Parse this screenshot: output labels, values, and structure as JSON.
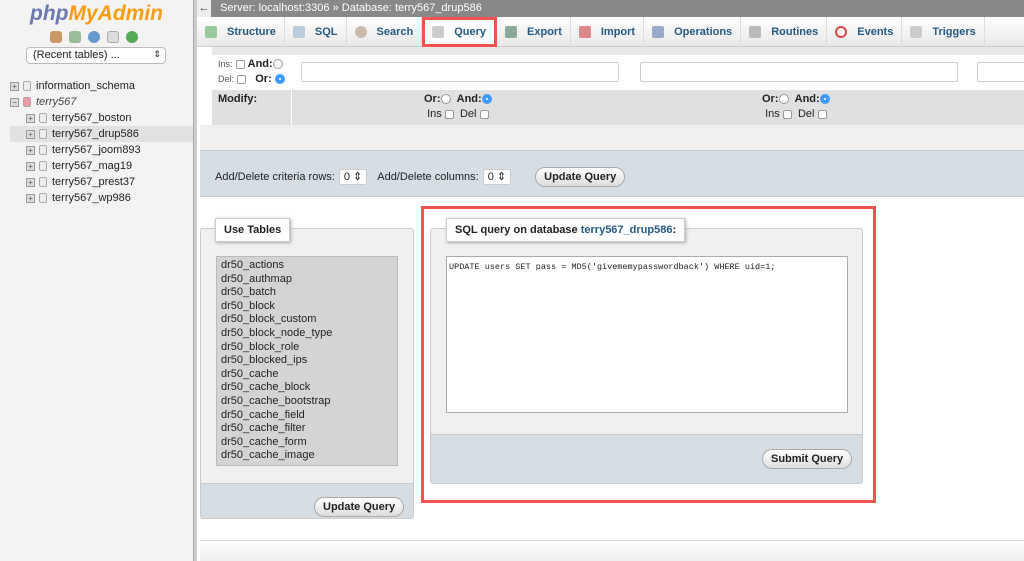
{
  "sidebar": {
    "logo": "phpMyAdmin",
    "logo_php": "php",
    "logo_ma": "MyAdmin",
    "recent_tables": "(Recent tables) ...",
    "tree": [
      "information_schema",
      "terry567",
      "terry567_boston",
      "terry567_drup586",
      "terry567_joom893",
      "terry567_mag19",
      "terry567_prest37",
      "terry567_wp986"
    ]
  },
  "breadcrumb": {
    "server": "Server: localhost:3306",
    "sep": "»",
    "database": "Database: terry567_drup586"
  },
  "tabs": [
    "Structure",
    "SQL",
    "Search",
    "Query",
    "Export",
    "Import",
    "Operations",
    "Routines",
    "Events",
    "Triggers"
  ],
  "criteria": {
    "ins": "Ins:",
    "del": "Del:",
    "and": "And:",
    "or": "Or:",
    "modify": "Modify:",
    "ins2": "Ins",
    "del2": "Del"
  },
  "add_delete": {
    "rows_label": "Add/Delete criteria rows:",
    "rows_value": "0",
    "cols_label": "Add/Delete columns:",
    "cols_value": "0",
    "update": "Update Query"
  },
  "use_tables": {
    "legend": "Use Tables",
    "tables": [
      "dr50_actions",
      "dr50_authmap",
      "dr50_batch",
      "dr50_block",
      "dr50_block_custom",
      "dr50_block_node_type",
      "dr50_block_role",
      "dr50_blocked_ips",
      "dr50_cache",
      "dr50_cache_block",
      "dr50_cache_bootstrap",
      "dr50_cache_field",
      "dr50_cache_filter",
      "dr50_cache_form",
      "dr50_cache_image"
    ],
    "update": "Update Query"
  },
  "sql_query": {
    "legend_prefix": "SQL query on database ",
    "database": "terry567_drup586",
    "legend_suffix": ":",
    "query": "UPDATE users SET pass = MD5('givememypasswordback') WHERE uid=1;",
    "submit": "Submit Query"
  },
  "colors": {
    "highlight": "#f0524d",
    "link": "#235a81"
  }
}
